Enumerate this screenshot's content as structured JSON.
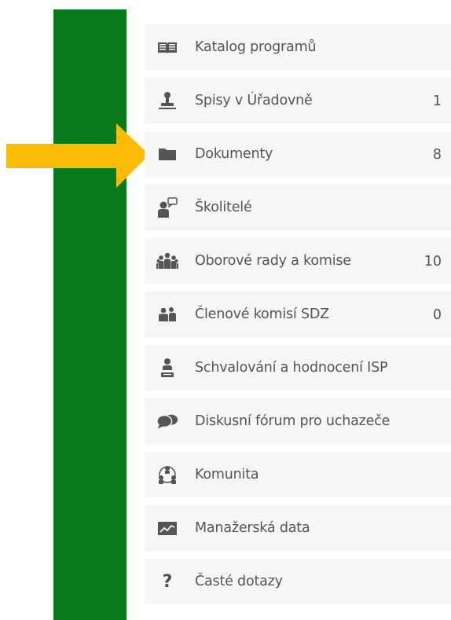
{
  "colors": {
    "sidebar_green": "#087a1b",
    "arrow": "#fbbc05",
    "item_bg": "#f6f6f6",
    "text": "#555555"
  },
  "menu": {
    "items": [
      {
        "label": "Katalog programů",
        "count": "",
        "icon": "book-icon"
      },
      {
        "label": "Spisy v Úřadovně",
        "count": "1",
        "icon": "stamp-icon"
      },
      {
        "label": "Dokumenty",
        "count": "8",
        "icon": "folder-icon"
      },
      {
        "label": "Školitelé",
        "count": "",
        "icon": "supervisor-icon"
      },
      {
        "label": "Oborové rady a komise",
        "count": "10",
        "icon": "group-icon"
      },
      {
        "label": "Členové komisí SDZ",
        "count": "0",
        "icon": "users-icon"
      },
      {
        "label": "Schvalování a hodnocení ISP",
        "count": "",
        "icon": "person-review-icon"
      },
      {
        "label": "Diskusní fórum pro uchazeče",
        "count": "",
        "icon": "chat-icon"
      },
      {
        "label": "Komunita",
        "count": "",
        "icon": "community-icon"
      },
      {
        "label": "Manažerská data",
        "count": "",
        "icon": "chart-icon"
      },
      {
        "label": "Časté dotazy",
        "count": "",
        "icon": "question-icon",
        "glyph": "?"
      }
    ]
  }
}
